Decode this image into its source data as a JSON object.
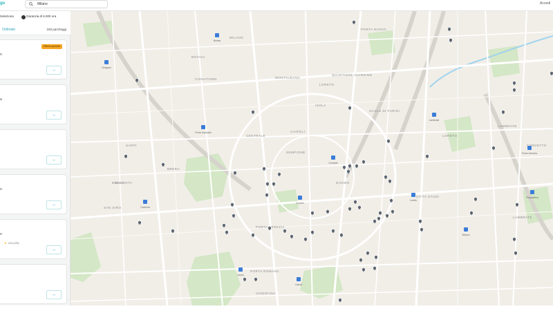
{
  "app": {
    "logo": "go"
  },
  "search": {
    "value": "Milano"
  },
  "account": {
    "label": "Accedi"
  },
  "filters": {
    "sort_label": "Ordinato",
    "chip_brand": "Seleziona",
    "chip_guarantee": "Garanzia di 5.000 ora"
  },
  "sidebar": {
    "count_label": "150 parcheggi",
    "cards": [
      {
        "title": "o",
        "badge": "Offerta speciale",
        "sub": ""
      },
      {
        "title": "a",
        "badge": "",
        "sub": ""
      },
      {
        "title": "",
        "badge": "",
        "sub": ""
      },
      {
        "title": "o",
        "badge": "",
        "sub": ""
      },
      {
        "title": "o",
        "badge": "",
        "sub": "4.5 (123)"
      },
      {
        "title": "",
        "badge": "",
        "sub": ""
      }
    ],
    "go_glyph": "→"
  },
  "map": {
    "colors": {
      "land": "#f1eee8",
      "park": "#cfe5c0",
      "road": "#ffffff",
      "rail": "#dcdcdc",
      "water": "#9fd3ee",
      "pin": "#5d6670",
      "metro": "#3b7dd8",
      "label": "#8a8a8a"
    },
    "icons": {
      "parking_pin": "parking-pin-icon",
      "metro_stop": "metro-station-icon"
    },
    "district_labels": [
      "BOVISA",
      "MONTALBANO",
      "QUARTIERE GIARDINO",
      "SCALO DI FARINI",
      "ISOLA",
      "CENTRALE",
      "SEMPIONE",
      "SARPI",
      "MAGENTA",
      "PORTA VENEZIA",
      "BRERA",
      "LORETO",
      "PORTA ROMANA",
      "DUOMO",
      "SAN SIRO",
      "VIGENTINA",
      "BOLLA",
      "CITTÀ STUDI",
      "LAMBRATE",
      "LAMBRATE",
      "LORETO",
      "PORTA NUOVA",
      "CORVETTO",
      "CHINATOWN",
      "MILANO",
      "CAIROLI"
    ],
    "station_labels": [
      "Bovisa",
      "Dergano",
      "Porta Garibaldi",
      "Centrale",
      "Cadorna",
      "Duomo",
      "Lambrate",
      "Loreto",
      "Porta Venezia",
      "Repubblica",
      "Lanza",
      "Cairoli",
      "Missori"
    ]
  }
}
